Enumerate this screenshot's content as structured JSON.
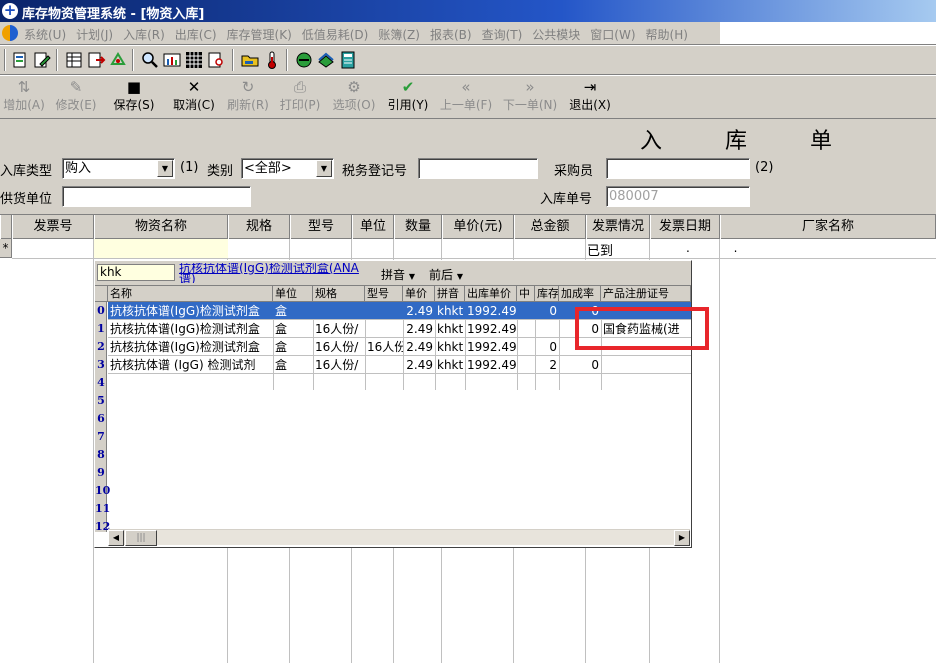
{
  "window": {
    "title": "库存物资管理系统 - [物资入库]"
  },
  "menu": [
    "系统(U)",
    "计划(J)",
    "入库(R)",
    "出库(C)",
    "库存管理(K)",
    "低值易耗(D)",
    "账簿(Z)",
    "报表(B)",
    "查询(T)",
    "公共模块",
    "窗口(W)",
    "帮助(H)"
  ],
  "toolbar_icons": [
    "open-doc-icon",
    "edit-doc-icon",
    "table-icon",
    "export-icon",
    "recycle-icon",
    "search-icon",
    "chart-icon",
    "grid-icon",
    "print-preview-icon",
    "folder-hand-icon",
    "thermometer-icon",
    "stop-icon",
    "books-icon",
    "calc-icon"
  ],
  "actions": [
    {
      "label": "增加(A)",
      "icon": "add-icon",
      "enabled": false
    },
    {
      "label": "修改(E)",
      "icon": "edit-icon",
      "enabled": false
    },
    {
      "label": "保存(S)",
      "icon": "save-icon",
      "enabled": true
    },
    {
      "label": "取消(C)",
      "icon": "cancel-icon",
      "enabled": true
    },
    {
      "label": "刷新(R)",
      "icon": "refresh-icon",
      "enabled": false
    },
    {
      "label": "打印(P)",
      "icon": "print-icon",
      "enabled": false
    },
    {
      "label": "选项(O)",
      "icon": "options-icon",
      "enabled": false
    },
    {
      "label": "引用(Y)",
      "icon": "reference-icon",
      "enabled": true
    },
    {
      "label": "上一单(F)",
      "icon": "prev-icon",
      "enabled": false
    },
    {
      "label": "下一单(N)",
      "icon": "next-icon",
      "enabled": false
    },
    {
      "label": "退出(X)",
      "icon": "exit-icon",
      "enabled": true
    }
  ],
  "form": {
    "title": "入 库 单",
    "type_label": "入库类型",
    "type_value": "购入",
    "type_hint": "(1)",
    "category_label": "类别",
    "category_value": "<全部>",
    "tax_label": "税务登记号",
    "tax_value": "",
    "buyer_label": "采购员",
    "buyer_value": "",
    "buyer_hint": "(2)",
    "supplier_label": "供货单位",
    "supplier_value": "",
    "doc_no_label": "入库单号",
    "doc_no_value": "080007"
  },
  "grid": {
    "columns": [
      "发票号",
      "物资名称",
      "规格",
      "型号",
      "单位",
      "数量",
      "单价(元)",
      "总金额",
      "发票情况",
      "发票日期",
      "厂家名称"
    ],
    "new_row_marker": "*",
    "row0": {
      "invoice_status": "已到",
      "invoice_date": ". ."
    }
  },
  "popup": {
    "search_value": "khk",
    "preview_text": "抗核抗体谱(IgG)检测试剂盒(ANA谱)",
    "sort_label": "拼音",
    "match_label": "前后",
    "columns": [
      "名称",
      "单位",
      "规格",
      "型号",
      "单价",
      "拼音",
      "出库单价",
      "中",
      "库存",
      "加成率",
      "产品注册证号"
    ],
    "rows": [
      {
        "name": "抗核抗体谱(IgG)检测试剂盒",
        "unit": "盒",
        "spec": "",
        "model": "",
        "price": "2.49",
        "pinyin": "khkt",
        "out_price": "1992.49",
        "mid": "",
        "stock": "0",
        "markup": "0",
        "reg_no": ""
      },
      {
        "name": "抗核抗体谱(IgG)检测试剂盒",
        "unit": "盒",
        "spec": "16人份/",
        "model": "",
        "price": "2.49",
        "pinyin": "khkt",
        "out_price": "1992.49",
        "mid": "",
        "stock": "",
        "markup": "0",
        "reg_no": "国食药监械(进"
      },
      {
        "name": "抗核抗体谱(IgG)检测试剂盒",
        "unit": "盒",
        "spec": "16人份/",
        "model": "16人份",
        "price": "2.49",
        "pinyin": "khkt",
        "out_price": "1992.49",
        "mid": "",
        "stock": "0",
        "markup": "",
        "reg_no": ""
      },
      {
        "name": "抗核抗体谱 (IgG) 检测试剂",
        "unit": "盒",
        "spec": "16人份/",
        "model": "",
        "price": "2.49",
        "pinyin": "khkt",
        "out_price": "1992.49",
        "mid": "",
        "stock": "2",
        "markup": "0",
        "reg_no": ""
      }
    ],
    "row_numbers": [
      "0",
      "1",
      "2",
      "3",
      "4",
      "5",
      "6",
      "7",
      "8",
      "9",
      "10",
      "11",
      "12"
    ],
    "selected_row": 0
  },
  "colors": {
    "title_bar": "#0a246a",
    "selection": "#316ac5",
    "highlight_box": "#e8262b",
    "row_number": "#0000a0"
  }
}
